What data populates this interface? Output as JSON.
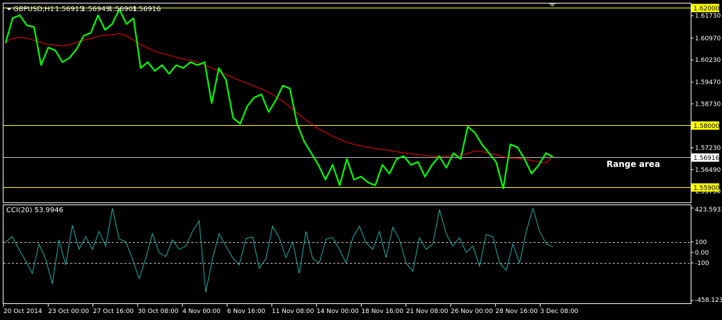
{
  "main_header": {
    "symbol": "GBPUSD,H1",
    "open": "1.56915",
    "high": "1.56949",
    "low": "1.56901",
    "close": "1.56916"
  },
  "annotation": "Range area",
  "colors": {
    "background": "#000000",
    "price_series": "#00ff00",
    "moving_average": "#ff0000",
    "level_lines": "#ffff00",
    "current_price_line": "#c0c0c0",
    "cci_series": "#20b2aa",
    "axis_text": "#ffffff",
    "frame": "#ffffff"
  },
  "chart_data": [
    {
      "type": "line",
      "title": "GBPUSD,H1",
      "ylim": [
        1.5537,
        1.6215
      ],
      "y_ticks": [
        "1.61730",
        "1.60970",
        "1.60230",
        "1.59470",
        "1.58730",
        "1.57230",
        "1.56490",
        "1.55750"
      ],
      "x_tick_labels": [
        "20 Oct 2014",
        "23 Oct 00:00",
        "27 Oct 16:00",
        "30 Oct 08:00",
        "4 Nov 00:00",
        "6 Nov 16:00",
        "11 Nov 08:00",
        "14 Nov 00:00",
        "18 Nov 16:00",
        "21 Nov 08:00",
        "26 Nov 00:00",
        "28 Nov 16:00",
        "3 Dec 08:00"
      ],
      "levels": [
        {
          "label": "1.62000",
          "value": 1.62
        },
        {
          "label": "1.58000",
          "value": 1.58
        },
        {
          "label": "1.55900",
          "value": 1.559
        }
      ],
      "current_price": {
        "label": "1.56916",
        "value": 1.56916
      },
      "series": [
        {
          "role": "price",
          "values": [
            1.608,
            1.6165,
            1.6175,
            1.614,
            1.6135,
            1.6005,
            1.6065,
            1.6055,
            1.6015,
            1.603,
            1.606,
            1.6105,
            1.6115,
            1.6175,
            1.6125,
            1.6145,
            1.6195,
            1.6145,
            1.6165,
            1.5995,
            1.6015,
            1.5985,
            1.6005,
            1.5975,
            1.6005,
            1.5995,
            1.6015,
            1.6005,
            1.6015,
            1.5875,
            1.5995,
            1.5955,
            1.5825,
            1.5805,
            1.5865,
            1.5895,
            1.5905,
            1.5845,
            1.5885,
            1.5935,
            1.5925,
            1.5805,
            1.5745,
            1.5705,
            1.5665,
            1.5615,
            1.5665,
            1.5595,
            1.5685,
            1.5615,
            1.5625,
            1.5605,
            1.5595,
            1.5665,
            1.5635,
            1.5685,
            1.5695,
            1.5665,
            1.5675,
            1.5625,
            1.5665,
            1.5695,
            1.5655,
            1.5705,
            1.5685,
            1.5795,
            1.5775,
            1.5735,
            1.5705,
            1.5675,
            1.5585,
            1.5735,
            1.5725,
            1.5685,
            1.5635,
            1.5665,
            1.5705,
            1.5692
          ]
        },
        {
          "role": "moving_average",
          "values": [
            1.6085,
            1.6095,
            1.61,
            1.6096,
            1.609,
            1.6082,
            1.6075,
            1.6073,
            1.607,
            1.6075,
            1.6082,
            1.609,
            1.6095,
            1.6103,
            1.6107,
            1.6109,
            1.6112,
            1.6105,
            1.609,
            1.6075,
            1.6063,
            1.6052,
            1.6045,
            1.6038,
            1.6032,
            1.6026,
            1.6021,
            1.6015,
            1.6005,
            1.5995,
            1.5985,
            1.5973,
            1.5962,
            1.5952,
            1.5943,
            1.5933,
            1.5923,
            1.5912,
            1.5898,
            1.5882,
            1.5862,
            1.5842,
            1.5822,
            1.5805,
            1.5788,
            1.5775,
            1.5762,
            1.5752,
            1.5742,
            1.5735,
            1.573,
            1.5725,
            1.5721,
            1.5717,
            1.5714,
            1.571,
            1.5706,
            1.5703,
            1.57,
            1.5697,
            1.5694,
            1.5694,
            1.5695,
            1.5697,
            1.5699,
            1.5703,
            1.5713,
            1.571,
            1.5705,
            1.57,
            1.5692,
            1.5688,
            1.5688,
            1.5685,
            1.568,
            1.5675,
            1.5672,
            1.5694
          ]
        }
      ]
    },
    {
      "type": "line",
      "title": "CCI(20) 53.9946",
      "ylim": [
        -458.1239,
        423.5933
      ],
      "y_ticks": [
        "423.5933",
        "100",
        "0.00",
        "-100",
        "-458.1239"
      ],
      "reference_levels": [
        100,
        -100
      ],
      "series": [
        {
          "role": "cci",
          "values": [
            100,
            150,
            30,
            -80,
            -200,
            80,
            -60,
            -300,
            120,
            -120,
            260,
            30,
            150,
            30,
            200,
            60,
            420,
            130,
            100,
            -60,
            -250,
            -60,
            180,
            0,
            -40,
            120,
            30,
            60,
            200,
            300,
            -380,
            -60,
            180,
            60,
            -50,
            -120,
            130,
            150,
            -150,
            -60,
            250,
            140,
            -50,
            100,
            -200,
            200,
            -60,
            -100,
            130,
            140,
            30,
            -100,
            140,
            250,
            90,
            30,
            200,
            -50,
            240,
            120,
            -100,
            -180,
            140,
            30,
            80,
            410,
            180,
            60,
            140,
            0,
            60,
            -130,
            170,
            150,
            -100,
            -170,
            80,
            -100,
            200,
            420,
            200,
            80,
            54
          ]
        }
      ]
    }
  ]
}
